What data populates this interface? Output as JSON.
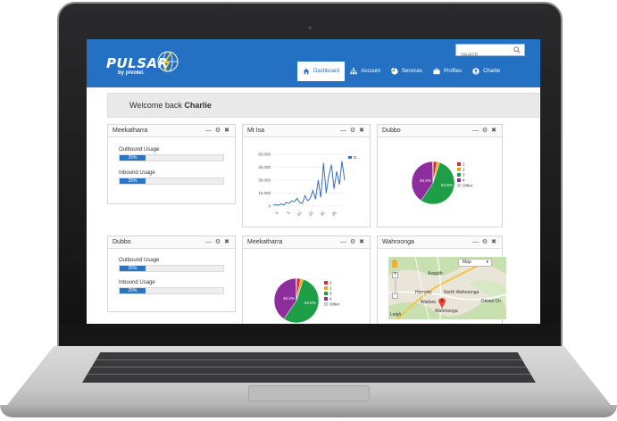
{
  "app": {
    "logo": "PULSAR",
    "logo_sub": "by pivotel."
  },
  "search": {
    "placeholder": "Search"
  },
  "nav": [
    {
      "label": "Dashboard",
      "icon": "home-icon"
    },
    {
      "label": "Account",
      "icon": "sitemap-icon"
    },
    {
      "label": "Services",
      "icon": "pie-icon"
    },
    {
      "label": "Profiles",
      "icon": "briefcase-icon"
    },
    {
      "label": "Charlie",
      "icon": "user-icon"
    }
  ],
  "welcome": {
    "prefix": "Welcome back ",
    "user": "Charlie"
  },
  "widget_controls": "— ⚙ ✖",
  "widgets": {
    "w1": {
      "title": "Meekatharra",
      "outbound_label": "Outbound Usage",
      "outbound_value": "25%",
      "outbound_fraction": 0.25,
      "inbound_label": "Inbound Usage",
      "inbound_value": "25%",
      "inbound_fraction": 0.25
    },
    "w2": {
      "title": "Mt Isa"
    },
    "w3": {
      "title": "Dubbo"
    },
    "w4": {
      "title": "Dubbo",
      "outbound_label": "Outbound Usage",
      "outbound_value": "25%",
      "outbound_fraction": 0.25,
      "inbound_label": "Inbound Usage",
      "inbound_value": "25%",
      "inbound_fraction": 0.25
    },
    "w5": {
      "title": "Meekatharra"
    },
    "w6": {
      "title": "Wahroonga",
      "map_type": "Map"
    }
  },
  "pie_legend": [
    "1",
    "2",
    "3",
    "4",
    "Other"
  ],
  "pie_colors": [
    "#d2322d",
    "#f0a30a",
    "#1f9e48",
    "#8e2d9c",
    "#cccccc"
  ],
  "pie_labels": {
    "big": "54.5%",
    "small": "40.2%"
  },
  "map_labels": [
    "Asquith",
    "Hornsby",
    "North Wahroonga",
    "Waitara",
    "Wahroonga",
    "Drives Ch",
    "Leigh"
  ],
  "accent": "#2471c3",
  "chart_data": [
    {
      "type": "line",
      "title": "Mt Isa",
      "ylim": [
        0,
        60000
      ],
      "yticks": [
        "60,000",
        "45,000",
        "30,000",
        "15,000",
        "0"
      ],
      "xticks": [
        "0",
        "5",
        "10",
        "15",
        "20",
        "25"
      ],
      "series": [
        {
          "name": "D...",
          "values": [
            1000,
            1500,
            800,
            2500,
            1200,
            4000,
            3000,
            6000,
            5000,
            9000,
            4000,
            3000,
            12000,
            6000,
            9000,
            18000,
            8000,
            30000,
            10000,
            50000,
            15000,
            35000,
            48000,
            20000,
            40000,
            25000,
            52000,
            30000
          ]
        }
      ]
    },
    {
      "type": "pie",
      "title": "Dubbo",
      "categories": [
        "1",
        "2",
        "3",
        "4",
        "Other"
      ],
      "values": [
        3,
        2,
        54.5,
        40.2,
        0.3
      ]
    },
    {
      "type": "pie",
      "title": "Meekatharra",
      "categories": [
        "1",
        "2",
        "3",
        "4",
        "Other"
      ],
      "values": [
        3,
        2,
        54.5,
        40.2,
        0.3
      ]
    }
  ]
}
